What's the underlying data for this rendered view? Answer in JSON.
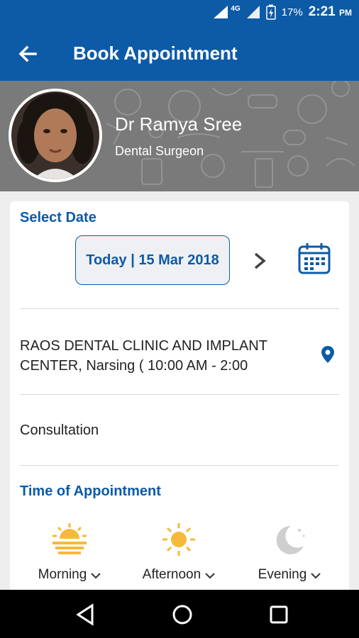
{
  "status_bar": {
    "network": "4G",
    "battery": "17%",
    "time": "2:21",
    "ampm": "PM"
  },
  "app_bar": {
    "title": "Book Appointment"
  },
  "doctor": {
    "name": "Dr Ramya Sree",
    "specialty": "Dental Surgeon"
  },
  "select_date": {
    "heading": "Select Date",
    "value": "Today | 15 Mar 2018"
  },
  "clinic": {
    "text": "RAOS DENTAL CLINIC AND IMPLANT CENTER, Narsing ( 10:00 AM - 2:00"
  },
  "consultation": {
    "label": "Consultation"
  },
  "time_of_appointment": {
    "heading": "Time of Appointment",
    "slots": [
      {
        "label": "Morning",
        "icon": "sunrise-icon"
      },
      {
        "label": "Afternoon",
        "icon": "sun-icon"
      },
      {
        "label": "Evening",
        "icon": "moon-icon"
      }
    ]
  },
  "colors": {
    "primary": "#0d5aa7",
    "sun": "#f6b93b",
    "moon": "#cfcfcf"
  }
}
